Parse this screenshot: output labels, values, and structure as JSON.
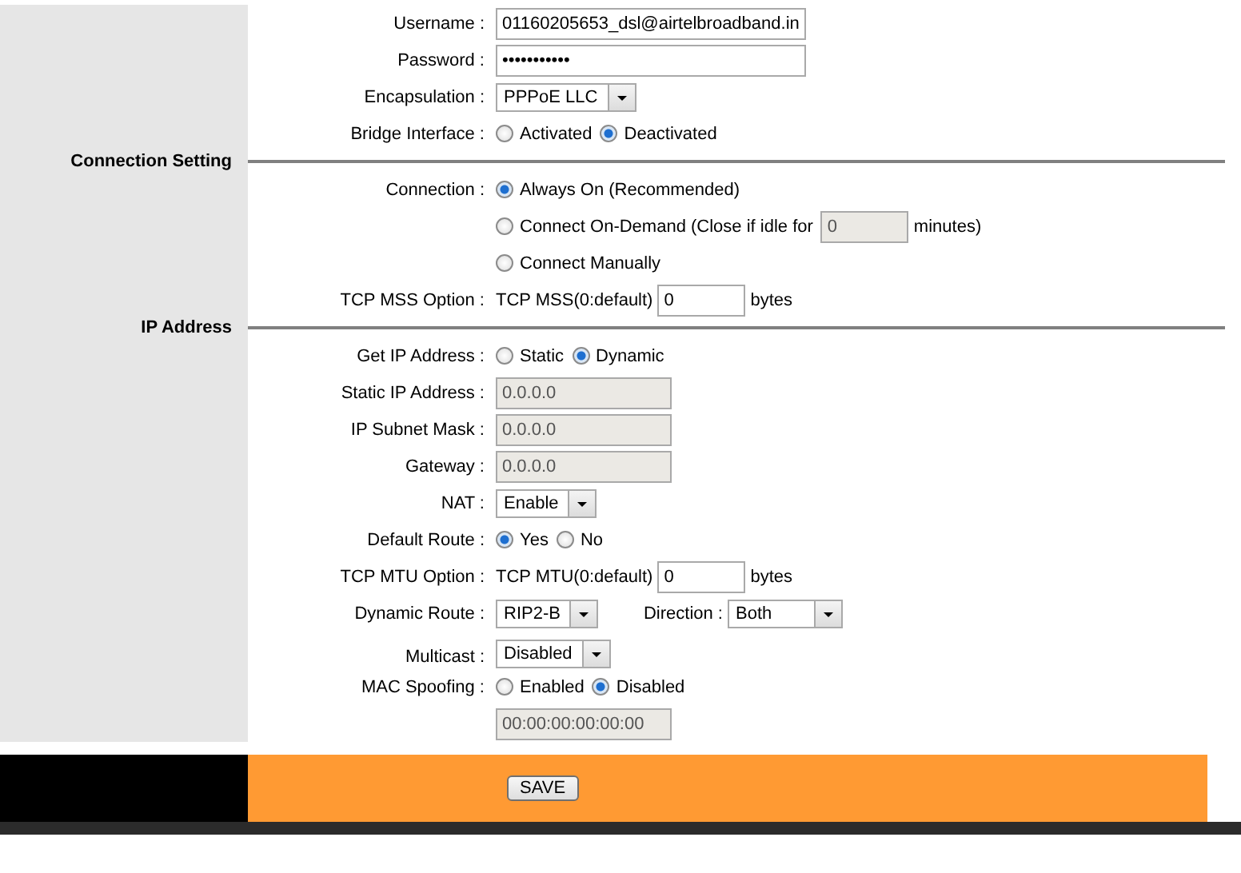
{
  "sections": [
    {
      "rows": [
        {
          "label": "Username :",
          "items": [
            {
              "kind": "field",
              "value": "01160205653_dsl@airtelbroadband.in",
              "disabled": false
            }
          ]
        },
        {
          "label": "Password :",
          "items": [
            {
              "kind": "field",
              "value": "•••••••••••",
              "disabled": false
            }
          ]
        },
        {
          "label": "Encapsulation :",
          "items": [
            {
              "kind": "select",
              "value": "PPPoE LLC"
            }
          ]
        },
        {
          "label": "Bridge Interface :",
          "items": [
            {
              "kind": "radio",
              "text": "Activated",
              "selected": false
            },
            {
              "kind": "radio",
              "text": "Deactivated",
              "selected": true
            }
          ]
        }
      ]
    },
    {
      "heading": "Connection Setting",
      "rows": [
        {
          "label": "Connection :",
          "items": [
            {
              "kind": "radio",
              "text": "Always On (Recommended)",
              "selected": true
            }
          ]
        },
        {
          "items": [
            {
              "kind": "radio",
              "text": "Connect On-Demand (Close if idle for",
              "selected": false
            },
            {
              "kind": "field",
              "value": "0",
              "disabled": true
            },
            {
              "kind": "text",
              "text": "minutes)"
            }
          ]
        },
        {
          "items": [
            {
              "kind": "radio",
              "text": "Connect Manually",
              "selected": false
            }
          ]
        },
        {
          "label": "TCP MSS Option :",
          "items": [
            {
              "kind": "text",
              "text": "TCP MSS(0:default)"
            },
            {
              "kind": "field",
              "value": "0",
              "disabled": false
            },
            {
              "kind": "text",
              "text": "bytes"
            }
          ]
        }
      ]
    },
    {
      "heading": "IP Address",
      "rows": [
        {
          "label": "Get IP Address :",
          "items": [
            {
              "kind": "radio",
              "text": "Static",
              "selected": false
            },
            {
              "kind": "radio",
              "text": "Dynamic",
              "selected": true
            }
          ]
        },
        {
          "label": "Static IP Address :",
          "items": [
            {
              "kind": "field",
              "value": "0.0.0.0",
              "disabled": true
            }
          ]
        },
        {
          "label": "IP Subnet Mask :",
          "items": [
            {
              "kind": "field",
              "value": "0.0.0.0",
              "disabled": true
            }
          ]
        },
        {
          "label": "Gateway :",
          "items": [
            {
              "kind": "field",
              "value": "0.0.0.0",
              "disabled": true
            }
          ]
        },
        {
          "label": "NAT :",
          "items": [
            {
              "kind": "select",
              "value": "Enable"
            }
          ]
        },
        {
          "label": "Default Route :",
          "items": [
            {
              "kind": "radio",
              "text": "Yes",
              "selected": true
            },
            {
              "kind": "radio",
              "text": "No",
              "selected": false
            }
          ]
        },
        {
          "label": "TCP MTU Option :",
          "items": [
            {
              "kind": "text",
              "text": "TCP MTU(0:default)"
            },
            {
              "kind": "field",
              "value": "0",
              "disabled": false
            },
            {
              "kind": "text",
              "text": "bytes"
            }
          ]
        },
        {
          "label": "Dynamic Route :",
          "items": [
            {
              "kind": "select",
              "value": "RIP2-B"
            },
            {
              "kind": "label",
              "text": "Direction :"
            },
            {
              "kind": "select",
              "value": "Both"
            }
          ]
        },
        {
          "label": "Multicast :",
          "items": [
            {
              "kind": "select",
              "value": "Disabled"
            }
          ]
        },
        {
          "label": "MAC Spoofing :",
          "items": [
            {
              "kind": "radio",
              "text": "Enabled",
              "selected": false
            },
            {
              "kind": "radio",
              "text": "Disabled",
              "selected": true
            }
          ]
        },
        {
          "items": [
            {
              "kind": "field",
              "value": "00:00:00:00:00:00",
              "disabled": true
            }
          ]
        }
      ]
    }
  ],
  "save_button": "SAVE"
}
